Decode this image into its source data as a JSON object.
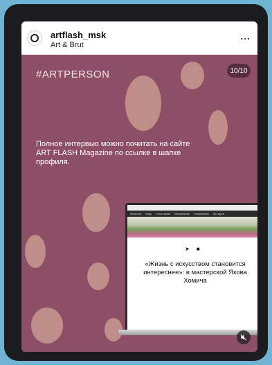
{
  "post": {
    "username": "artflash_msk",
    "subtitle": "Art & Brut",
    "more_label": "..."
  },
  "media": {
    "hashtag": "#ARTPERSON",
    "counter": "10/10",
    "caption": "Полное интервью можно почитать на сайте ART FLASH Magazine по ссылке в шапке профиля.",
    "laptop": {
      "nav_items": [
        "Искусство",
        "Мода",
        "Стиль жизни",
        "Мероприятия",
        "Спецпроекты",
        "Арт-карты"
      ],
      "headline": "«Жизнь с искусством становится интереснее»: в мастерской Якова Хомича"
    }
  },
  "colors": {
    "background": "#6fb5d3",
    "media_bg": "#8e4f66"
  },
  "icons": {
    "avatar": "circle-logo-icon",
    "more": "more-horizontal-icon",
    "mute": "speaker-muted-icon",
    "telegram": "telegram-icon",
    "vk": "vk-icon"
  }
}
